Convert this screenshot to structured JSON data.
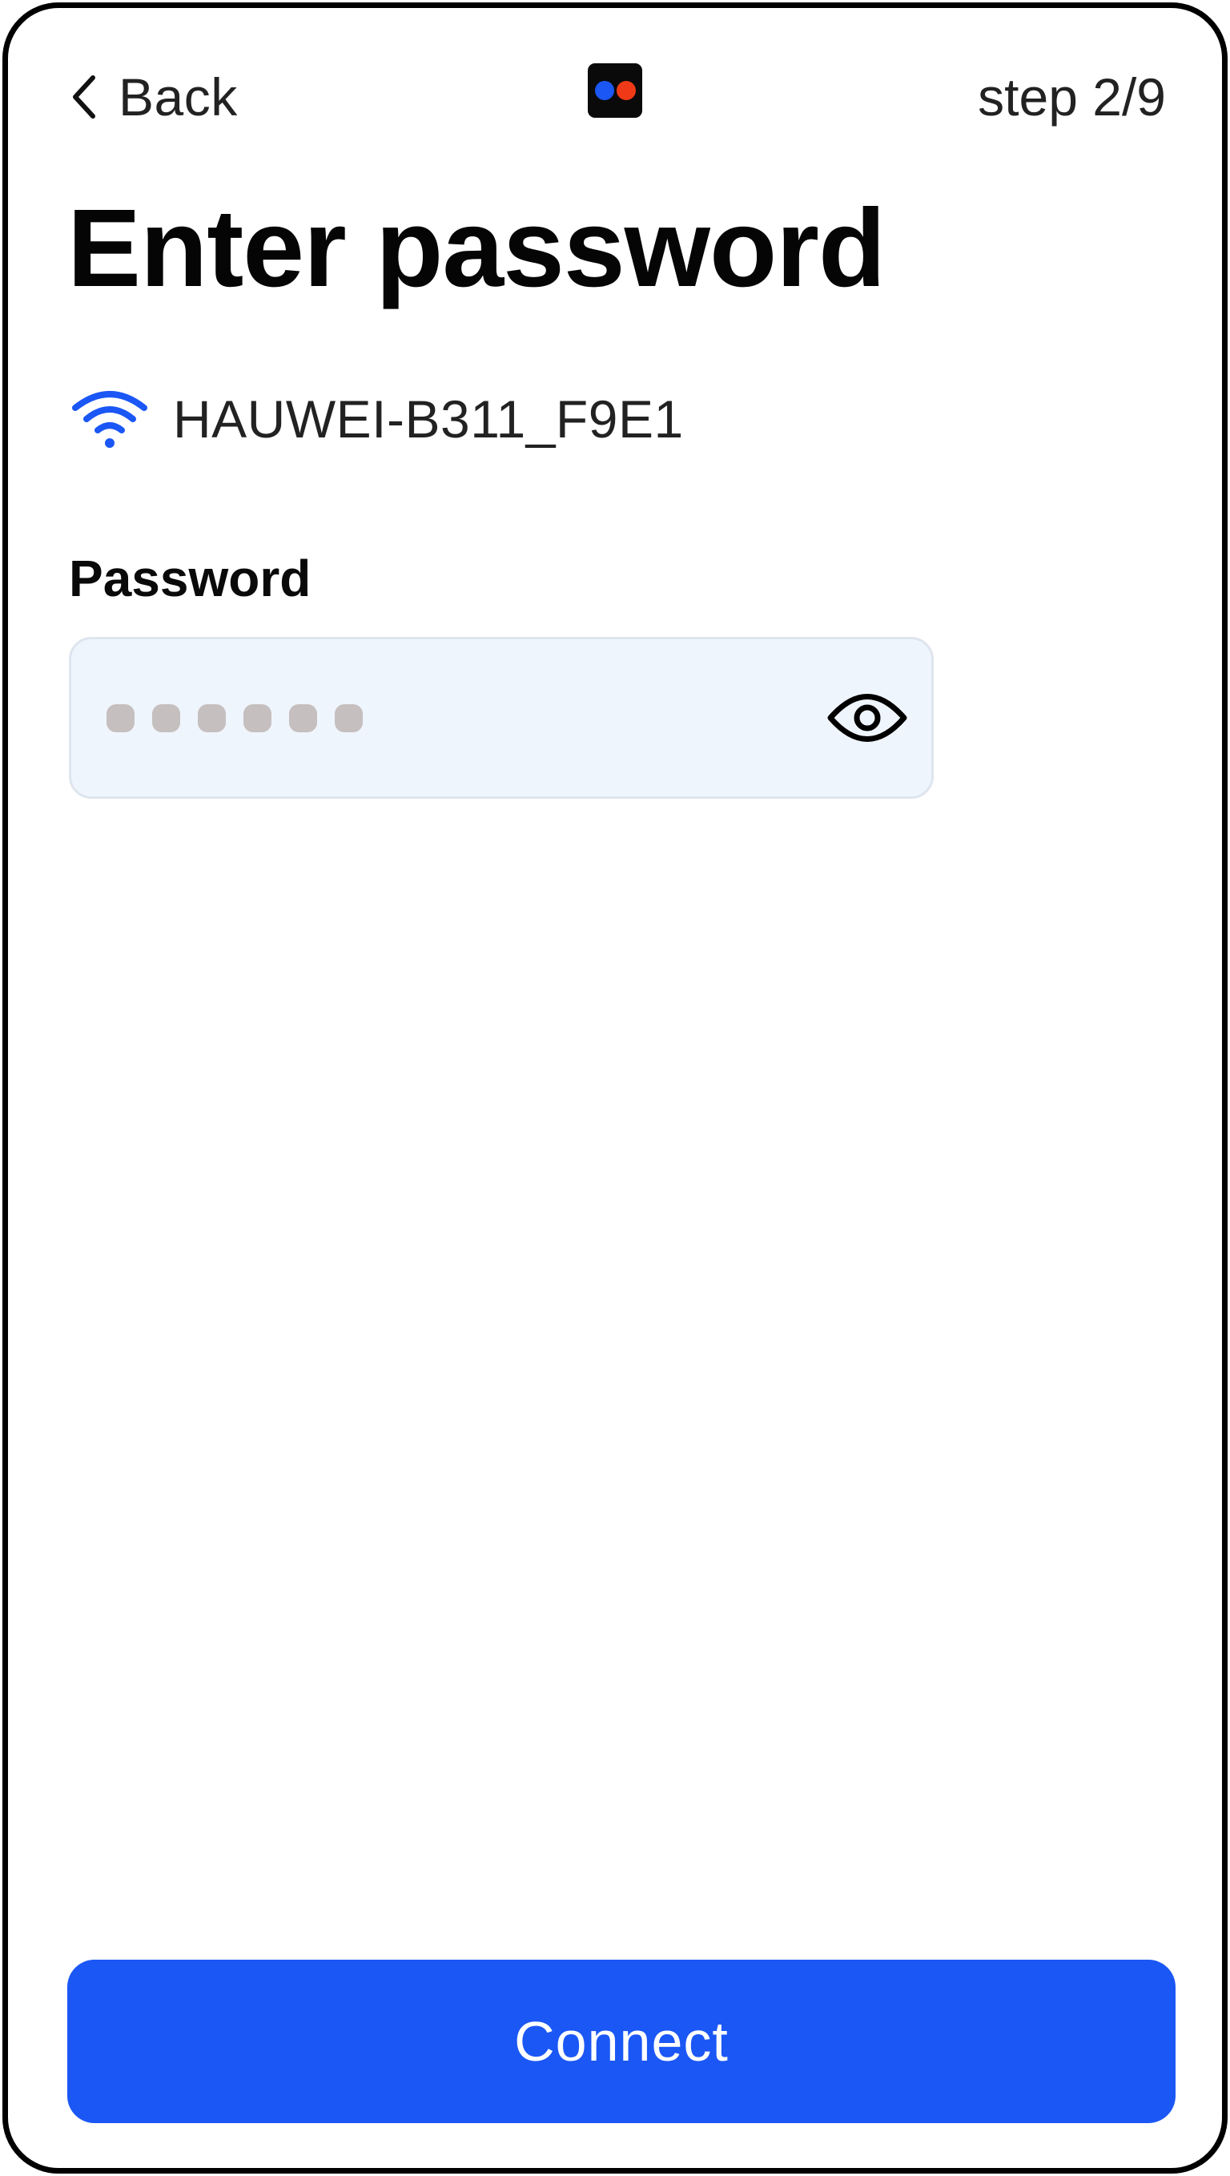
{
  "header": {
    "back_label": "Back",
    "back_icon": "chevron-left-icon",
    "step_label": "step 2/9",
    "logo": {
      "icon": "app-logo-icon",
      "dot_colors": [
        "#1b57f5",
        "#f03a17"
      ]
    }
  },
  "page": {
    "title": "Enter password"
  },
  "network": {
    "icon": "wifi-icon",
    "name": "HAUWEI-B311_F9E1",
    "icon_color": "#1b57f5"
  },
  "password": {
    "label": "Password",
    "masked_length": 6,
    "toggle_icon": "eye-icon"
  },
  "actions": {
    "connect_label": "Connect",
    "connect_color": "#1b57f5"
  }
}
